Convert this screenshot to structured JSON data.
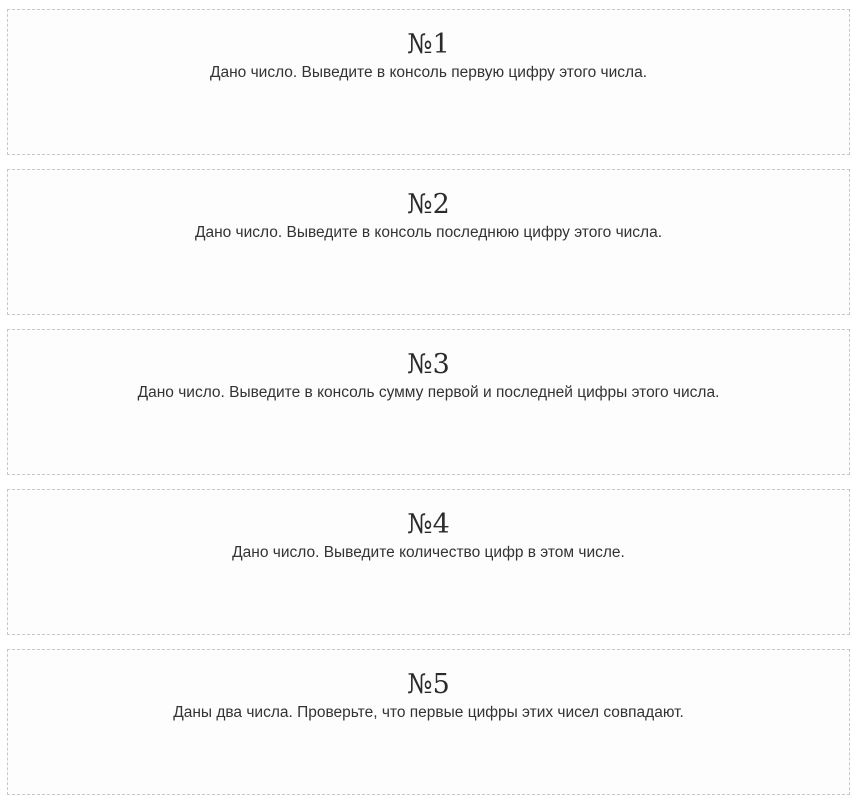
{
  "tasks": [
    {
      "number": "№1",
      "text": "Дано число. Выведите в консоль первую цифру этого числа."
    },
    {
      "number": "№2",
      "text": "Дано число. Выведите в консоль последнюю цифру этого числа."
    },
    {
      "number": "№3",
      "text": "Дано число. Выведите в консоль сумму первой и последней цифры этого числа."
    },
    {
      "number": "№4",
      "text": "Дано число. Выведите количество цифр в этом числе."
    },
    {
      "number": "№5",
      "text": "Даны два числа. Проверьте, что первые цифры этих чисел совпадают."
    }
  ]
}
